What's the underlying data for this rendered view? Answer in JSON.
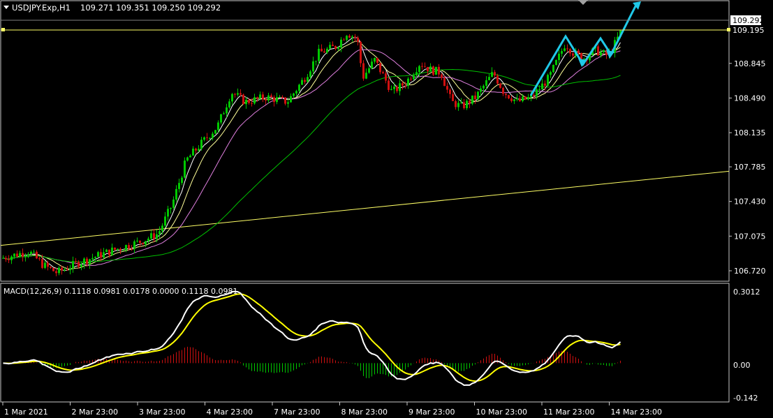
{
  "chart_data": {
    "type": "candlestick",
    "symbol_header": "USDJPY.Exp,H1",
    "ohlc_header": "109.271 109.351 109.250 109.292",
    "current_price": "109.292",
    "hline_price": "109.195",
    "price_ticks": [
      "109.195",
      "108.845",
      "108.490",
      "108.135",
      "107.785",
      "107.430",
      "107.075",
      "106.720"
    ],
    "price_range": [
      106.62,
      109.48
    ],
    "time_labels": [
      "1 Mar 2021",
      "2 Mar 23:00",
      "3 Mar 23:00",
      "4 Mar 23:00",
      "7 Mar 23:00",
      "8 Mar 23:00",
      "9 Mar 23:00",
      "10 Mar 23:00",
      "11 Mar 23:00",
      "14 Mar 23:00"
    ],
    "macd": {
      "header": "MACD(12,26,9) 0.1118 0.0981 0.0178 0.0000 0.1118 0.0981",
      "ticks": [
        "0.3012",
        "0.00",
        "-0.142"
      ],
      "range": [
        -0.142,
        0.3012
      ]
    },
    "colors": {
      "background": "#000000",
      "bull": "#00c800",
      "bear": "#d01010",
      "ma_fast": "#ffffff",
      "ma_mid": "#ffff99",
      "ma_slow": "#e080e0",
      "ma_long": "#00c000",
      "trendline": "#ffff66",
      "arrows": "#20c8e8",
      "macd_line": "#ffffff",
      "signal_line": "#ffff00"
    }
  }
}
